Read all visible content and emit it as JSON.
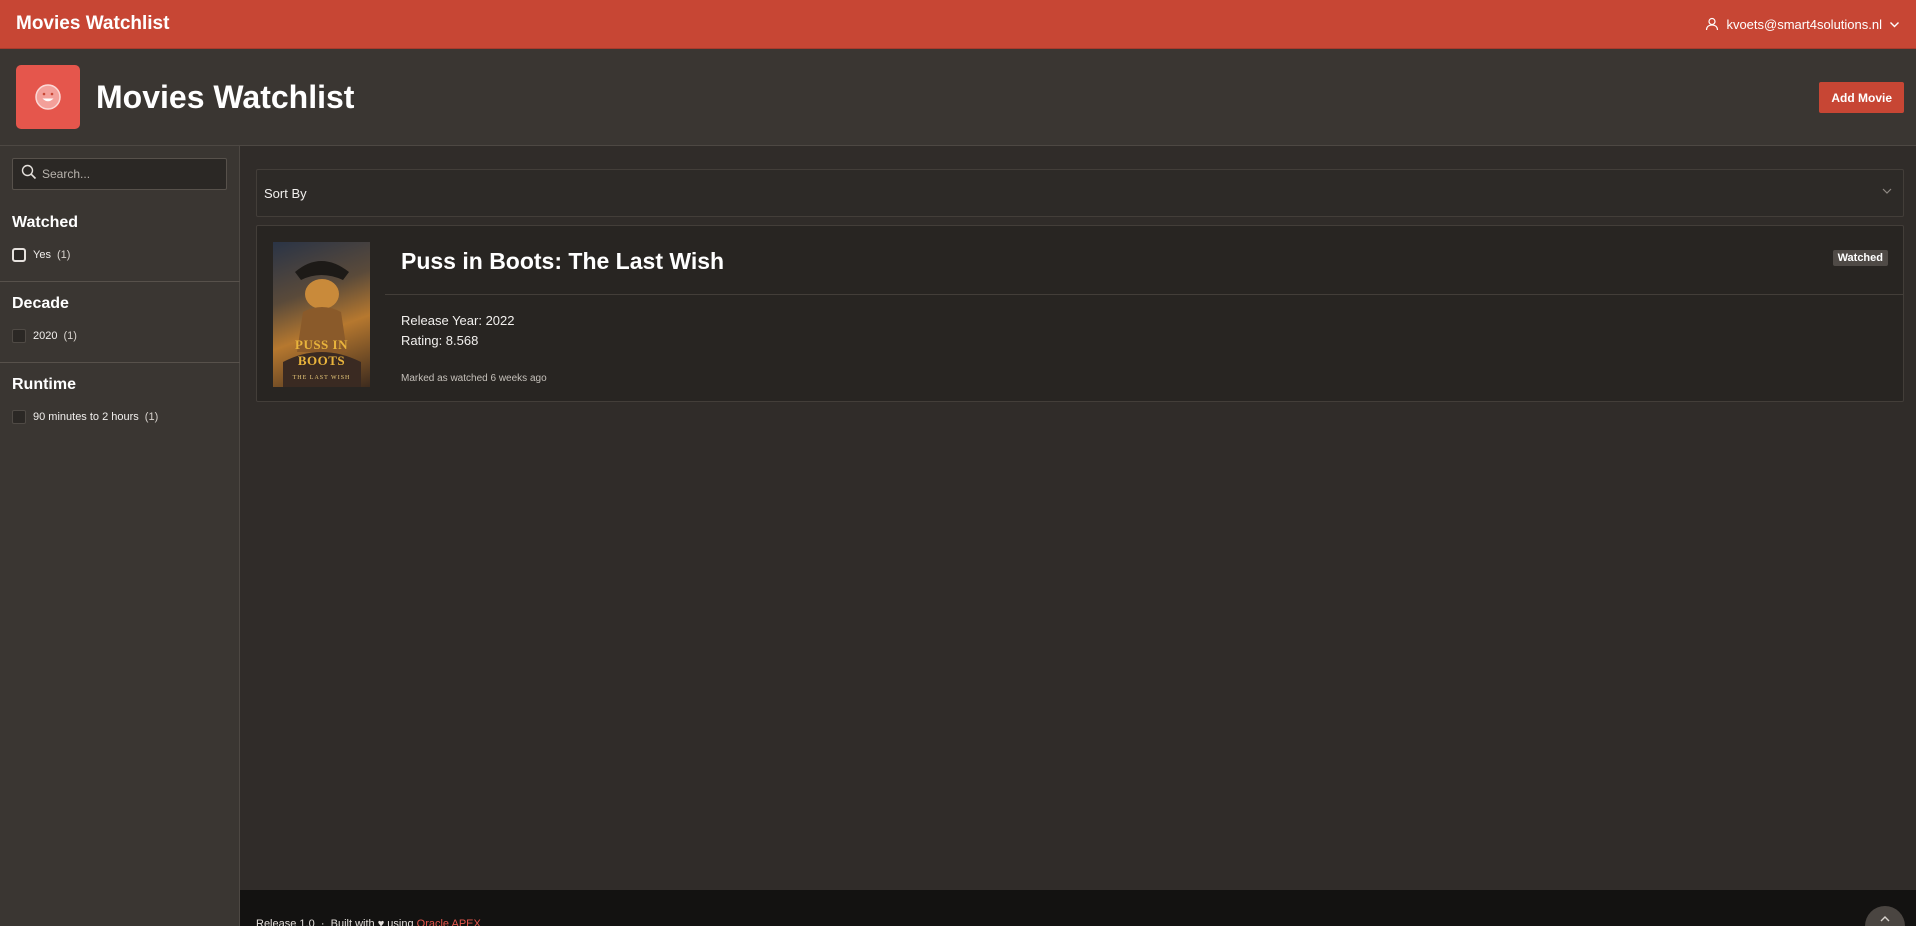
{
  "app": {
    "title": "Movies Watchlist"
  },
  "user": {
    "email": "kvoets@smart4solutions.nl"
  },
  "page": {
    "title": "Movies Watchlist",
    "add_button": "Add Movie"
  },
  "search": {
    "placeholder": "Search..."
  },
  "facets": [
    {
      "title": "Watched",
      "options": [
        {
          "label": "Yes",
          "count": "(1)"
        }
      ]
    },
    {
      "title": "Decade",
      "options": [
        {
          "label": "2020",
          "count": "(1)"
        }
      ]
    },
    {
      "title": "Runtime",
      "options": [
        {
          "label": "90 minutes to 2 hours",
          "count": "(1)"
        }
      ]
    }
  ],
  "sort": {
    "label": "Sort By"
  },
  "movies": [
    {
      "title": "Puss in Boots: The Last Wish",
      "badge": "Watched",
      "release": "Release Year: 2022",
      "rating": "Rating: 8.568",
      "watched_note": "Marked as watched 6 weeks ago",
      "poster_title": "PUSS IN BOOTS",
      "poster_subtitle": "THE LAST WISH"
    }
  ],
  "footer": {
    "release": "Release 1.0",
    "built_with": "Built with",
    "using": "using",
    "link": "Oracle APEX"
  },
  "icons": {
    "user": "user-icon",
    "chevron": "chevron-down-icon",
    "search": "search-icon",
    "hero": "smiley-icon",
    "heart": "heart-icon",
    "scroll_top": "chevron-up-icon"
  },
  "colors": {
    "header": "#c74634",
    "accent": "#e5564c",
    "background": "#302c29",
    "panel": "#3a3632",
    "footer": "#131211"
  }
}
